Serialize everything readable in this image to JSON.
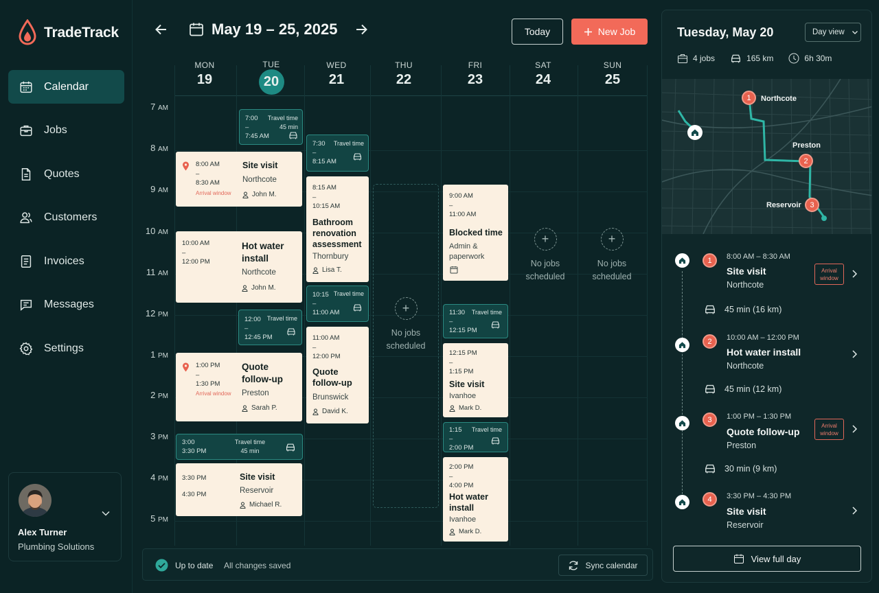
{
  "app": {
    "name": "TradeTrack"
  },
  "nav": [
    {
      "label": "Calendar",
      "icon": "calendar-icon",
      "active": true
    },
    {
      "label": "Jobs",
      "icon": "briefcase-icon"
    },
    {
      "label": "Quotes",
      "icon": "document-icon"
    },
    {
      "label": "Customers",
      "icon": "users-icon"
    },
    {
      "label": "Invoices",
      "icon": "invoice-icon"
    },
    {
      "label": "Messages",
      "icon": "message-icon"
    },
    {
      "label": "Settings",
      "icon": "gear-icon"
    }
  ],
  "user": {
    "name": "Alex Turner",
    "org": "Plumbing Solutions"
  },
  "header": {
    "range": "May 19 – 25, 2025",
    "today_label": "Today",
    "new_job_label": "New Job"
  },
  "days": [
    {
      "name": "MON",
      "num": "19"
    },
    {
      "name": "TUE",
      "num": "20"
    },
    {
      "name": "WED",
      "num": "21"
    },
    {
      "name": "THU",
      "num": "22"
    },
    {
      "name": "FRI",
      "num": "23"
    },
    {
      "name": "SAT",
      "num": "24"
    },
    {
      "name": "SUN",
      "num": "25"
    }
  ],
  "hours": [
    {
      "h": "7",
      "p": "AM"
    },
    {
      "h": "8",
      "p": "AM"
    },
    {
      "h": "9",
      "p": "AM"
    },
    {
      "h": "10",
      "p": "AM"
    },
    {
      "h": "11",
      "p": "AM"
    },
    {
      "h": "12",
      "p": "PM"
    },
    {
      "h": "1",
      "p": "PM"
    },
    {
      "h": "2",
      "p": "PM"
    },
    {
      "h": "3",
      "p": "PM"
    },
    {
      "h": "4",
      "p": "PM"
    },
    {
      "h": "5",
      "p": "PM"
    }
  ],
  "events": {
    "mon_tue_site": {
      "start": "8:00 AM",
      "end": "8:30 AM",
      "note": "Arrival window",
      "title": "Site visit",
      "loc": "Northcote",
      "person": "John M."
    },
    "mon_tue_hot": {
      "start": "10:00 AM",
      "end": "12:00 PM",
      "title1": "Hot water",
      "title2": "install",
      "loc": "Northcote",
      "person": "John M."
    },
    "mon_tue_quote": {
      "start": "1:00 PM",
      "end": "1:30 PM",
      "note": "Arrival window",
      "title1": "Quote",
      "title2": "follow-up",
      "loc": "Preston",
      "person": "Sarah P."
    },
    "mon_tue_site2": {
      "start": "3:30 PM",
      "end": "4:30 PM",
      "title": "Site visit",
      "loc": "Reservoir",
      "person": "Michael R."
    },
    "wed_bath": {
      "start": "8:15 AM",
      "end": "10:15 AM",
      "title1": "Bathroom",
      "title2": "renovation",
      "title3": "assessment",
      "loc": "Thornbury",
      "person": "Lisa T."
    },
    "wed_quote": {
      "start": "11:00 AM",
      "end": "12:00 PM",
      "title1": "Quote",
      "title2": "follow-up",
      "loc": "Brunswick",
      "person": "David K."
    },
    "fri_blocked": {
      "start": "9:00 AM",
      "end": "11:00 AM",
      "title": "Blocked time",
      "sub1": "Admin &",
      "sub2": "paperwork"
    },
    "fri_site": {
      "start": "12:15 PM",
      "end": "1:15 PM",
      "title": "Site visit",
      "loc": "Ivanhoe",
      "person": "Mark D."
    },
    "fri_hot": {
      "start": "2:00 PM",
      "end": "4:00 PM",
      "title1": "Hot water",
      "title2": "install",
      "loc": "Ivanhoe",
      "person": "Mark D."
    }
  },
  "travel": {
    "tue_a": {
      "start": "7:00",
      "end": "7:45 AM",
      "label": "Travel time",
      "dur": "45 min"
    },
    "tue_b": {
      "start": "12:00",
      "end": "12:45 PM",
      "label": "Travel time"
    },
    "montue_c": {
      "start": "3:00",
      "end": "3:30 PM",
      "label": "Travel time",
      "dur": "45 min"
    },
    "wed_a": {
      "start": "7:30",
      "end": "8:15 AM",
      "label": "Travel time"
    },
    "wed_b": {
      "start": "10:15",
      "end": "11:00 AM",
      "label": "Travel time"
    },
    "fri_a": {
      "start": "11:30",
      "end": "12:15 PM",
      "label": "Travel time"
    },
    "fri_b": {
      "start": "1:15",
      "end": "2:00 PM",
      "label": "Travel time"
    }
  },
  "empty": {
    "line1": "No jobs",
    "line2": "scheduled"
  },
  "status": {
    "state": "Up to date",
    "saved": "All changes saved",
    "sync_label": "Sync calendar"
  },
  "panel": {
    "title": "Tuesday, May 20",
    "view": "Day view",
    "stats": {
      "jobs": "4 jobs",
      "distance": "165 km",
      "duration": "6h 30m"
    },
    "map_labels": {
      "a": "Northcote",
      "b": "Preston",
      "c": "Reservoir"
    },
    "timeline": [
      {
        "n": "1",
        "time": "8:00 AM – 8:30 AM",
        "title": "Site visit",
        "loc": "Northcote",
        "badge1": "Arrival",
        "badge2": "window"
      },
      {
        "drive": "45 min (16 km)"
      },
      {
        "n": "2",
        "time": "10:00 AM – 12:00 PM",
        "title": "Hot water install",
        "loc": "Northcote"
      },
      {
        "drive": "45 min (12 km)"
      },
      {
        "n": "3",
        "time": "1:00 PM – 1:30 PM",
        "title": "Quote follow-up",
        "loc": "Preston",
        "badge1": "Arrival",
        "badge2": "window"
      },
      {
        "drive": "30 min (9 km)"
      },
      {
        "n": "4",
        "time": "3:30 PM – 4:30 PM",
        "title": "Site visit",
        "loc": "Reservoir"
      }
    ],
    "view_full": "View full day"
  },
  "colors": {
    "accent": "#f26a59",
    "teal": "#1e8a83",
    "bg": "#0c2426",
    "card": "#fbf0e1"
  }
}
